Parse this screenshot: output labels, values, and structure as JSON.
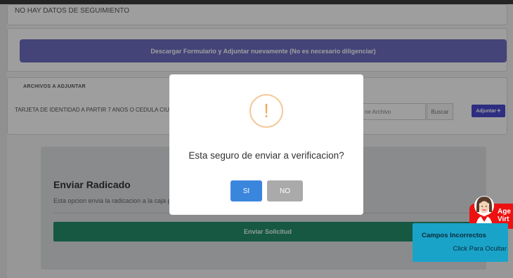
{
  "tracking": {
    "empty_text": "NO HAY DATOS DE SEGUIMIENTO",
    "download_button": "Descargar Formulario y Adjuntar nuevamente (No es necesario diligenciar)"
  },
  "files": {
    "title": "ARCHIVOS A ADJUNTAR",
    "item_label": "TARJETA DE IDENTIDAD A PARTIR 7 ANOS O CEDULA CIUDAD",
    "file_placeholder": "ne Archivo",
    "search_button": "Buscar",
    "attach_button": "Adjuntar",
    "attach_icon": "+"
  },
  "enviar": {
    "title": "Enviar Radicado",
    "description": "Esta opcion envia la radicacion a la caja pa",
    "submit_button": "Enviar Solicitud"
  },
  "dialog": {
    "icon": "warning-icon",
    "icon_glyph": "!",
    "question": "Esta seguro de enviar a verificacion?",
    "yes_button": "SI",
    "no_button": "NO"
  },
  "agent": {
    "label_line1": "Age",
    "label_line2": "Virt"
  },
  "toast": {
    "title": "Campos Incorrectos",
    "action": "Click Para Ocultar"
  },
  "colors": {
    "download_button": "#6f6fc4",
    "attach_button": "#4a4ad0",
    "submit_button": "#258f6b",
    "yes_button": "#3b86dd",
    "no_button": "#aaaaaa",
    "warning": "#f0a866",
    "toast": "#1aa3c9",
    "agent_tag": "#e11111"
  }
}
